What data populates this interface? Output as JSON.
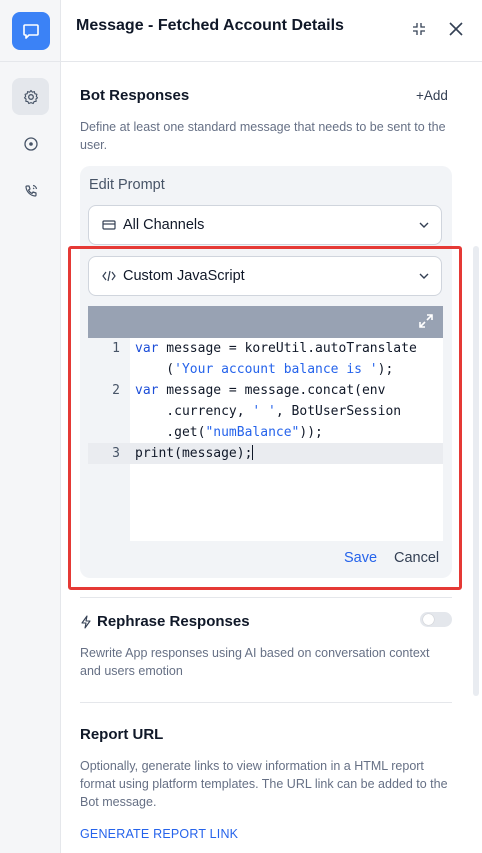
{
  "header": {
    "title": "Message - Fetched Account Details"
  },
  "bot_responses": {
    "title": "Bot Responses",
    "add_label": "+Add",
    "description": "Define at least one standard message that needs to be sent to the user."
  },
  "prompt": {
    "label": "Edit Prompt",
    "channel_select": "All Channels",
    "type_select": "Custom JavaScript",
    "code_lines": [
      {
        "number": "1",
        "parts": [
          {
            "text": "var",
            "cls": "kw"
          },
          {
            "text": " message = koreUtil.autoTranslate",
            "cls": ""
          }
        ]
      },
      {
        "number": "",
        "parts": [
          {
            "text": "    (",
            "cls": ""
          },
          {
            "text": "'Your account balance is '",
            "cls": "str"
          },
          {
            "text": ");",
            "cls": ""
          }
        ]
      },
      {
        "number": "2",
        "parts": [
          {
            "text": "var",
            "cls": "kw"
          },
          {
            "text": " message = message.concat(env",
            "cls": ""
          }
        ]
      },
      {
        "number": "",
        "parts": [
          {
            "text": "    .currency, ",
            "cls": ""
          },
          {
            "text": "' '",
            "cls": "str"
          },
          {
            "text": ", BotUserSession",
            "cls": ""
          }
        ]
      },
      {
        "number": "",
        "parts": [
          {
            "text": "    .get(",
            "cls": ""
          },
          {
            "text": "\"numBalance\"",
            "cls": "str"
          },
          {
            "text": "));",
            "cls": ""
          }
        ]
      },
      {
        "number": "3",
        "parts": [
          {
            "text": "print(message);",
            "cls": ""
          }
        ]
      }
    ],
    "save_label": "Save",
    "cancel_label": "Cancel"
  },
  "rephrase": {
    "title": "Rephrase Responses",
    "description": "Rewrite App responses using AI based on conversation context and users emotion",
    "enabled": false
  },
  "report": {
    "title": "Report URL",
    "description": "Optionally, generate links to view information in a HTML report format using platform templates. The URL link can be added to the Bot message.",
    "link_label": "GENERATE REPORT LINK"
  },
  "colors": {
    "accent": "#3b82f6",
    "link": "#2563eb",
    "highlight": "#e53935"
  }
}
